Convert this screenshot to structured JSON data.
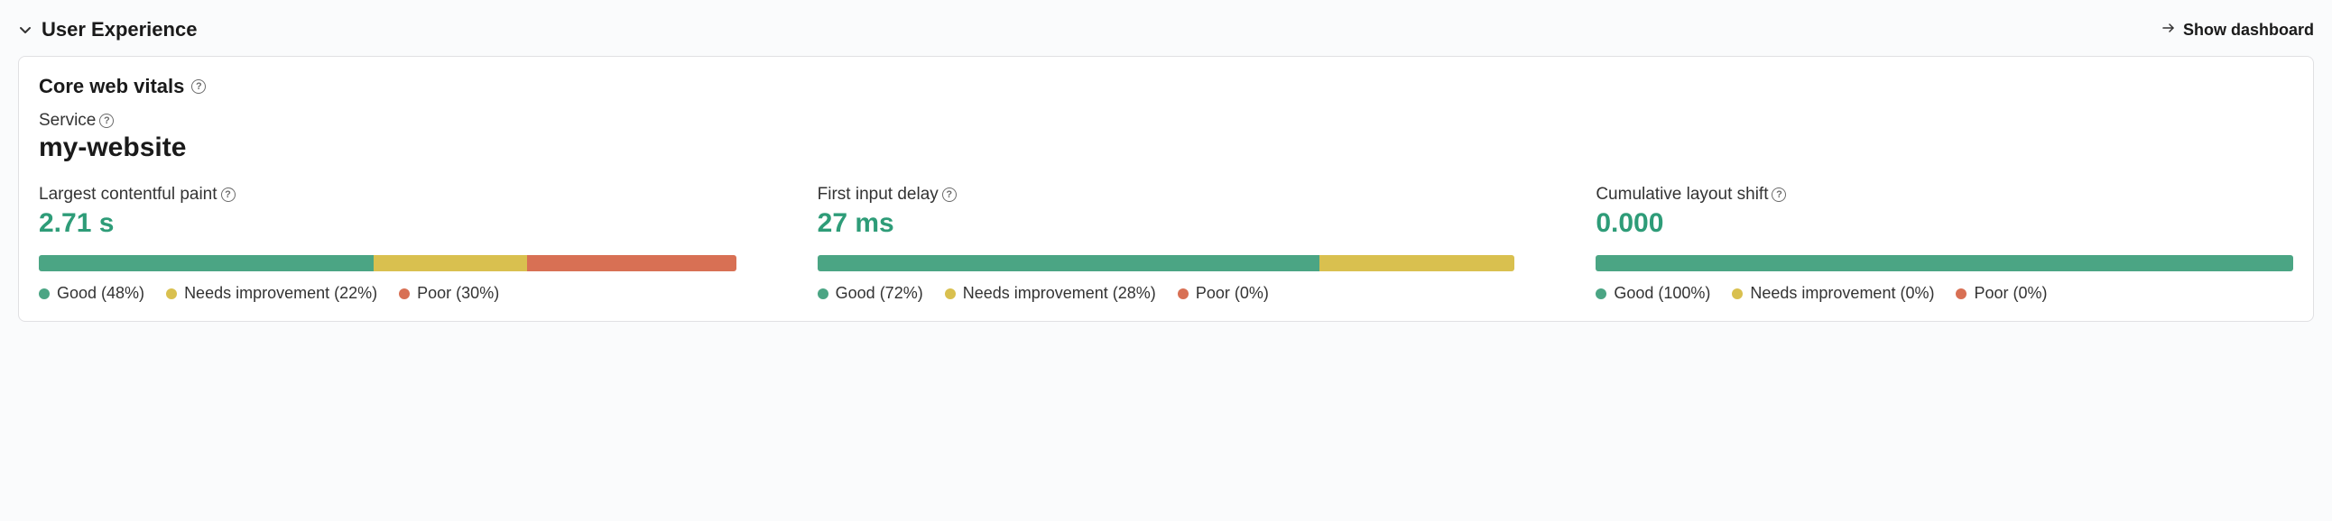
{
  "section": {
    "title": "User Experience",
    "show_dashboard_label": "Show dashboard"
  },
  "card": {
    "title": "Core web vitals",
    "service_label": "Service",
    "service_name": "my-website"
  },
  "colors": {
    "good": "#4ba584",
    "needs": "#d9c04f",
    "poor": "#d87054",
    "value": "#2e9c78"
  },
  "chart_data": {
    "type": "bar",
    "metrics": [
      {
        "key": "lcp",
        "label": "Largest contentful paint",
        "value": "2.71 s",
        "distribution": {
          "good": 48,
          "needs_improvement": 22,
          "poor": 30
        },
        "legend": {
          "good": "Good (48%)",
          "needs_improvement": "Needs improvement (22%)",
          "poor": "Poor (30%)"
        }
      },
      {
        "key": "fid",
        "label": "First input delay",
        "value": "27 ms",
        "distribution": {
          "good": 72,
          "needs_improvement": 28,
          "poor": 0
        },
        "legend": {
          "good": "Good (72%)",
          "needs_improvement": "Needs improvement (28%)",
          "poor": "Poor (0%)"
        }
      },
      {
        "key": "cls",
        "label": "Cumulative layout shift",
        "value": "0.000",
        "distribution": {
          "good": 100,
          "needs_improvement": 0,
          "poor": 0
        },
        "legend": {
          "good": "Good (100%)",
          "needs_improvement": "Needs improvement (0%)",
          "poor": "Poor (0%)"
        }
      }
    ]
  }
}
